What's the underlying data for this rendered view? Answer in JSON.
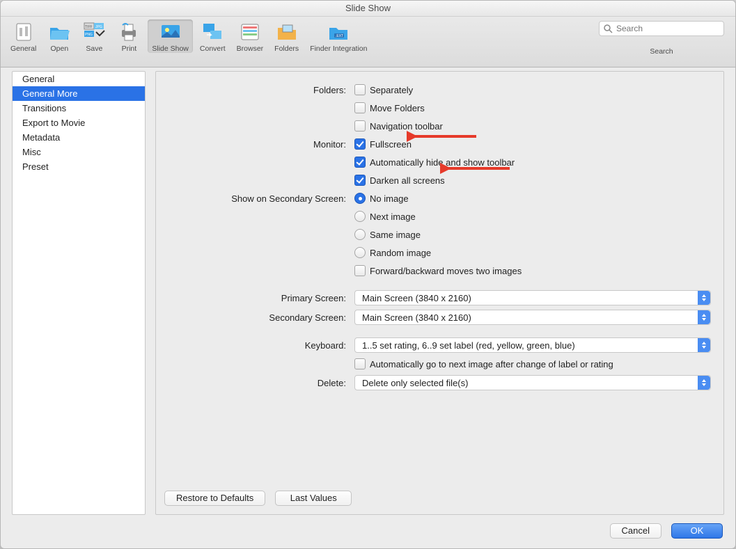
{
  "title": "Slide Show",
  "toolbar": {
    "items": [
      {
        "label": "General"
      },
      {
        "label": "Open"
      },
      {
        "label": "Save"
      },
      {
        "label": "Print"
      },
      {
        "label": "Slide Show"
      },
      {
        "label": "Convert"
      },
      {
        "label": "Browser"
      },
      {
        "label": "Folders"
      },
      {
        "label": "Finder Integration"
      }
    ],
    "search_placeholder": "Search",
    "search_label": "Search"
  },
  "sidebar": {
    "items": [
      {
        "label": "General"
      },
      {
        "label": "General More"
      },
      {
        "label": "Transitions"
      },
      {
        "label": "Export to Movie"
      },
      {
        "label": "Metadata"
      },
      {
        "label": "Misc"
      },
      {
        "label": "Preset"
      }
    ],
    "selected_index": 1
  },
  "form": {
    "folders_label": "Folders:",
    "folders_separately": "Separately",
    "folders_move": "Move Folders",
    "folders_nav": "Navigation toolbar",
    "monitor_label": "Monitor:",
    "monitor_fullscreen": "Fullscreen",
    "monitor_autohide": "Automatically hide and show toolbar",
    "monitor_darken": "Darken all screens",
    "secondary_label": "Show on Secondary Screen:",
    "sec_no": "No image",
    "sec_next": "Next image",
    "sec_same": "Same image",
    "sec_random": "Random image",
    "sec_fwdback": "Forward/backward moves two images",
    "primary_screen_label": "Primary Screen:",
    "primary_screen_value": "Main Screen (3840 x 2160)",
    "secondary_screen_label": "Secondary Screen:",
    "secondary_screen_value": "Main Screen (3840 x 2160)",
    "keyboard_label": "Keyboard:",
    "keyboard_value": "1..5 set rating, 6..9 set label (red, yellow, green, blue)",
    "keyboard_auto": "Automatically go to next image after change of label or rating",
    "delete_label": "Delete:",
    "delete_value": "Delete only selected file(s)"
  },
  "footer": {
    "restore": "Restore to Defaults",
    "last": "Last Values",
    "cancel": "Cancel",
    "ok": "OK"
  }
}
